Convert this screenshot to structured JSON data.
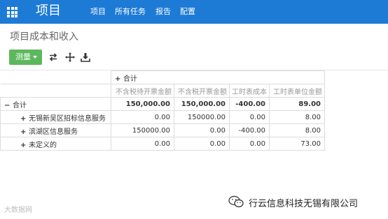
{
  "topbar": {
    "app_title": "项目",
    "nav": [
      "项目",
      "所有任务",
      "报告",
      "配置"
    ]
  },
  "page": {
    "title": "项目成本和收入"
  },
  "toolbar": {
    "measure_label": "测量",
    "icons": [
      "swap-axis-icon",
      "expand-all-icon",
      "download-icon"
    ]
  },
  "pivot": {
    "col_group": "合计",
    "measures": [
      "不含税待开票金额",
      "不含税开票金额",
      "工时表成本",
      "工时表单位金额"
    ],
    "total_row": {
      "label": "合计",
      "values": [
        "150,000.00",
        "150,000.00",
        "-400.00",
        "89.00"
      ]
    },
    "rows": [
      {
        "label": "无锡新吴区招标信息服务",
        "values": [
          "0.00",
          "150000.00",
          "0.00",
          "8.00"
        ]
      },
      {
        "label": "滨湖区信息服务",
        "values": [
          "150000.00",
          "0.00",
          "-400.00",
          "8.00"
        ]
      },
      {
        "label": "未定义的",
        "values": [
          "0.00",
          "0.00",
          "0.00",
          "73.00"
        ]
      }
    ]
  },
  "watermark": {
    "left": "大数据网",
    "right": "行云信息科技无锡有限公司"
  }
}
